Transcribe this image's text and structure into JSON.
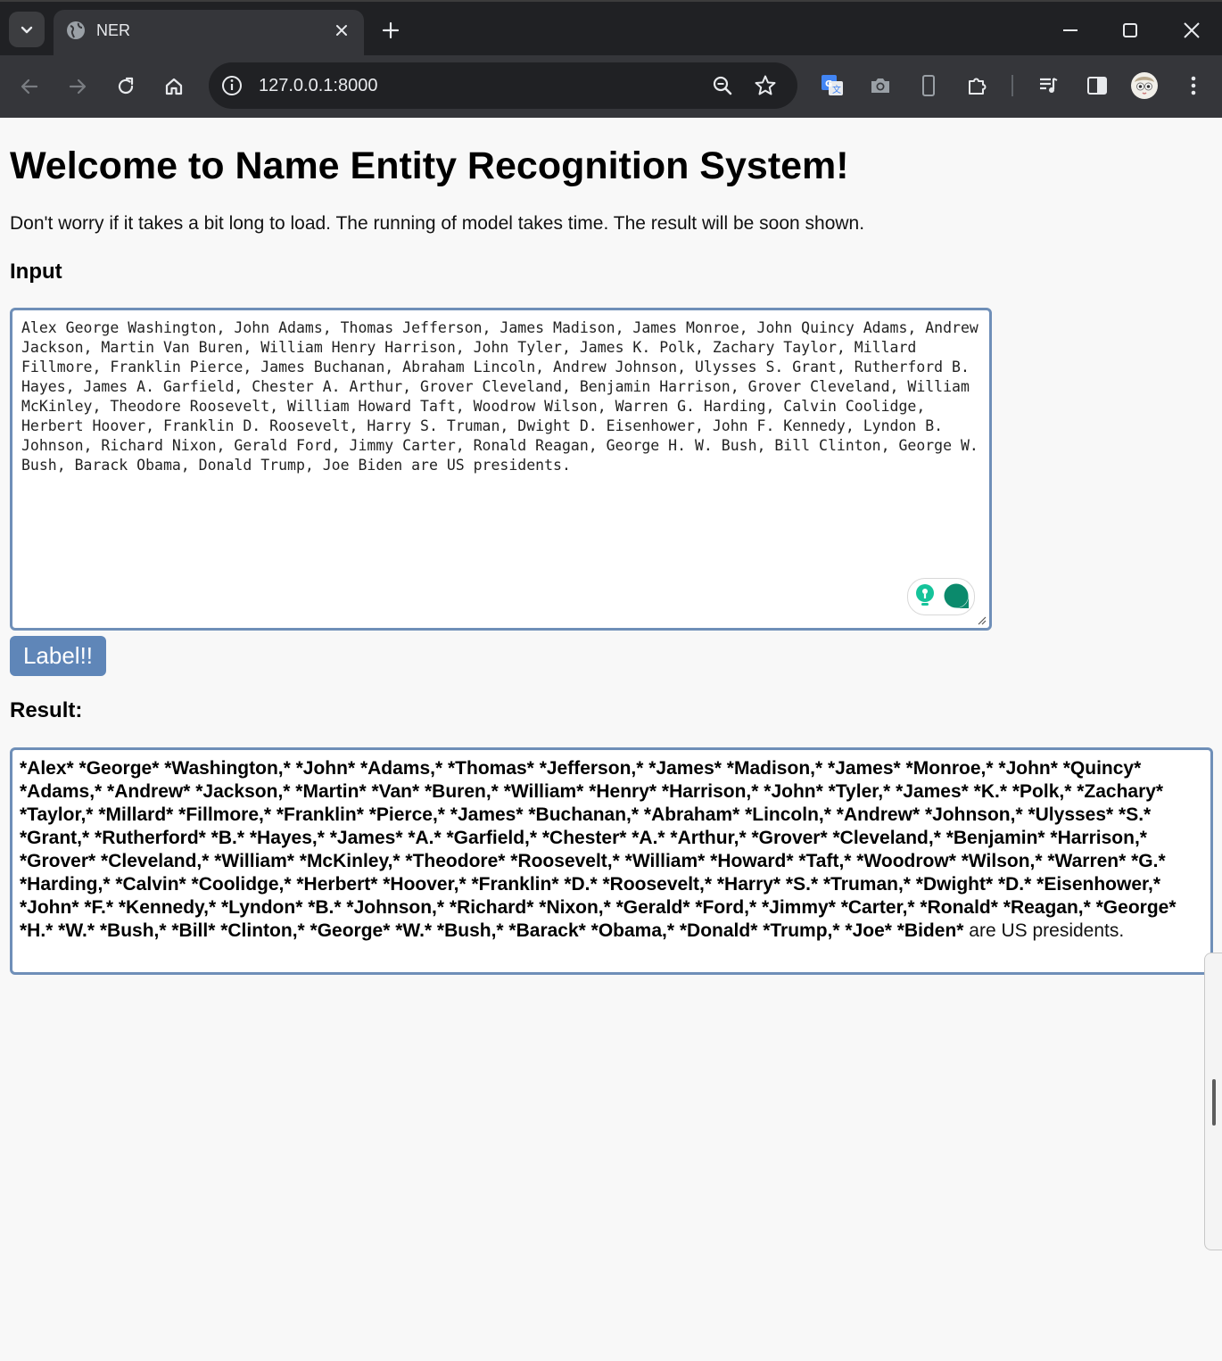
{
  "browser": {
    "tab_title": "NER",
    "url": "127.0.0.1:8000"
  },
  "page": {
    "heading": "Welcome to Name Entity Recognition System!",
    "intro": "Don't worry if it takes a bit long to load. The running of model takes time. The result will be soon shown.",
    "input_label": "Input",
    "input_text": "Alex George Washington, John Adams, Thomas Jefferson, James Madison, James Monroe, John Quincy Adams, Andrew Jackson, Martin Van Buren, William Henry Harrison, John Tyler, James K. Polk, Zachary Taylor, Millard Fillmore, Franklin Pierce, James Buchanan, Abraham Lincoln, Andrew Johnson, Ulysses S. Grant, Rutherford B. Hayes, James A. Garfield, Chester A. Arthur, Grover Cleveland, Benjamin Harrison, Grover Cleveland, William McKinley, Theodore Roosevelt, William Howard Taft, Woodrow Wilson, Warren G. Harding, Calvin Coolidge, Herbert Hoover, Franklin D. Roosevelt, Harry S. Truman, Dwight D. Eisenhower, John F. Kennedy, Lyndon B. Johnson, Richard Nixon, Gerald Ford, Jimmy Carter, Ronald Reagan, George H. W. Bush, Bill Clinton, George W. Bush, Barack Obama, Donald Trump, Joe Biden are US presidents.",
    "button_label": "Label!!",
    "result_label": "Result:",
    "result_entities": "*Alex* *George* *Washington,* *John* *Adams,* *Thomas* *Jefferson,* *James* *Madison,* *James* *Monroe,* *John* *Quincy* *Adams,* *Andrew* *Jackson,* *Martin* *Van* *Buren,* *William* *Henry* *Harrison,* *John* *Tyler,* *James* *K.* *Polk,* *Zachary* *Taylor,* *Millard* *Fillmore,* *Franklin* *Pierce,* *James* *Buchanan,* *Abraham* *Lincoln,* *Andrew* *Johnson,* *Ulysses* *S.* *Grant,* *Rutherford* *B.* *Hayes,* *James* *A.* *Garfield,* *Chester* *A.* *Arthur,* *Grover* *Cleveland,* *Benjamin* *Harrison,* *Grover* *Cleveland,* *William* *McKinley,* *Theodore* *Roosevelt,* *William* *Howard* *Taft,* *Woodrow* *Wilson,* *Warren* *G.* *Harding,* *Calvin* *Coolidge,* *Herbert* *Hoover,* *Franklin* *D.* *Roosevelt,* *Harry* *S.* *Truman,* *Dwight* *D.* *Eisenhower,* *John* *F.* *Kennedy,* *Lyndon* *B.* *Johnson,* *Richard* *Nixon,* *Gerald* *Ford,* *Jimmy* *Carter,* *Ronald* *Reagan,* *George* *H.* *W.* *Bush,* *Bill* *Clinton,* *George* *W.* *Bush,* *Barack* *Obama,* *Donald* *Trump,* *Joe* *Biden*",
    "result_plain": " are US presidents."
  },
  "icons": {
    "tab_search": "chevron-down-icon",
    "favicon": "globe-icon",
    "tab_close": "close-icon",
    "new_tab": "plus-icon",
    "minimize": "minimize-icon",
    "maximize": "maximize-icon",
    "window_close": "close-icon",
    "back": "arrow-left-icon",
    "forward": "arrow-right-icon",
    "reload": "reload-icon",
    "home": "home-icon",
    "site_info": "info-icon",
    "zoom": "zoom-icon",
    "bookmark": "star-icon",
    "extensions": [
      "google-translate-icon",
      "camera-icon",
      "phone-icon",
      "puzzle-icon"
    ],
    "media": "media-control-icon",
    "side_panel": "side-panel-icon",
    "profile": "avatar-icon",
    "menu": "kebab-menu-icon",
    "grammarly": "grammarly-icon"
  },
  "colors": {
    "frame": "#202124",
    "toolbar": "#35363a",
    "accent_border": "#6f8fb8",
    "button": "#5f86b8",
    "page_bg": "#f8f8f8"
  }
}
